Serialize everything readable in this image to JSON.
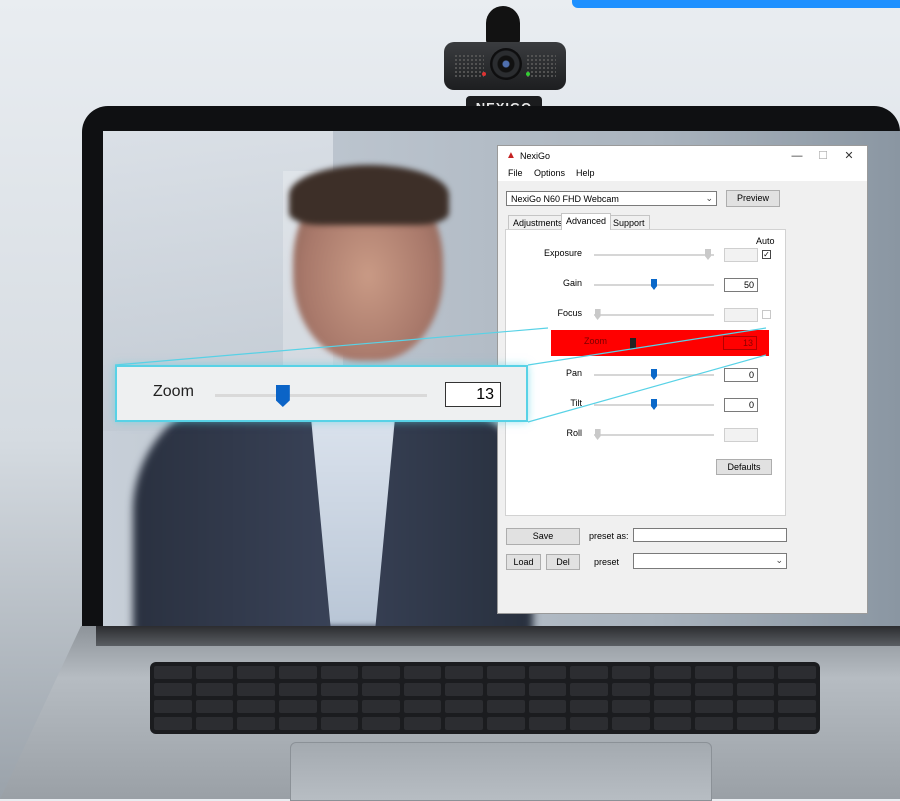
{
  "brand": {
    "webcam_logo": "NEXIGO"
  },
  "window": {
    "title": "NexiGo",
    "controls": {
      "minimize": "—",
      "maximize": "☐",
      "close": "✕"
    },
    "menu": [
      "File",
      "Options",
      "Help"
    ],
    "device_select": {
      "value": "NexiGo N60 FHD Webcam"
    },
    "preview_label": "Preview",
    "tabs": [
      {
        "label": "Adjustments",
        "active": false
      },
      {
        "label": "Advanced",
        "active": true
      },
      {
        "label": "Support",
        "active": false
      }
    ],
    "auto_header": "Auto",
    "controls_rows": [
      {
        "label": "Exposure",
        "value": "",
        "level": 0.95,
        "enabled": false,
        "auto": true
      },
      {
        "label": "Gain",
        "value": "50",
        "level": 0.5,
        "enabled": true,
        "auto": null
      },
      {
        "label": "Focus",
        "value": "",
        "level": 0.03,
        "enabled": false,
        "auto": false
      },
      {
        "label": "Zoom",
        "value": "13",
        "level": 0.33,
        "enabled": true,
        "auto": null,
        "highlighted": true
      },
      {
        "label": "Pan",
        "value": "0",
        "level": 0.5,
        "enabled": true,
        "auto": null
      },
      {
        "label": "Tilt",
        "value": "0",
        "level": 0.5,
        "enabled": true,
        "auto": null
      },
      {
        "label": "Roll",
        "value": "",
        "level": 0.03,
        "enabled": false,
        "auto": null
      }
    ],
    "defaults_label": "Defaults",
    "save_label": "Save",
    "preset_as_label": "preset as:",
    "preset_as_value": "",
    "load_label": "Load",
    "del_label": "Del",
    "preset_label": "preset",
    "preset_value": ""
  },
  "callout": {
    "label": "Zoom",
    "value": "13",
    "level": 0.32
  },
  "colors": {
    "highlight": "#ff0000",
    "accent": "#1e90ff",
    "callout_border": "#58d2e6",
    "slider_thumb": "#0a68c9"
  }
}
